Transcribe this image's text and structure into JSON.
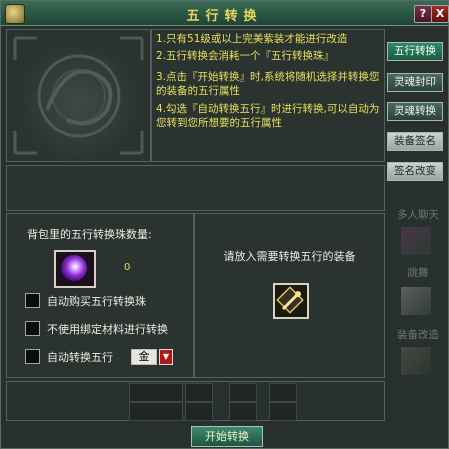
{
  "window": {
    "title": "五行转换",
    "help_label": "?",
    "close_label": "X"
  },
  "instructions": [
    "1.只有51级或以上完美紫装才能进行改造",
    "2.五行转换会消耗一个『五行转换珠』",
    "3.点击『开始转换』时,系统将随机选择并转换您的装备的五行属性",
    "4.勾选『自动转换五行』时进行转换,可以自动为您转到您所想要的五行属性"
  ],
  "left_panel": {
    "count_label": "背包里的五行转换珠数量:",
    "count_value": "0",
    "options": [
      {
        "label": "自动购买五行转换珠",
        "checked": false
      },
      {
        "label": "不使用绑定材料进行转换",
        "checked": false
      },
      {
        "label": "自动转换五行",
        "checked": false
      }
    ],
    "element_select": {
      "value": "金",
      "arrow": "▼"
    }
  },
  "right_panel": {
    "put_label": "请放入需要转换五行的装备"
  },
  "actions": {
    "start_label": "开始转换"
  },
  "side_tabs": [
    {
      "label": "五行转换",
      "state": "active"
    },
    {
      "label": "灵魂封印",
      "state": "normal"
    },
    {
      "label": "灵魂转换",
      "state": "normal"
    },
    {
      "label": "装备签名",
      "state": "light"
    },
    {
      "label": "签名改变",
      "state": "light"
    }
  ],
  "background_labels": [
    {
      "label": "多人聊天"
    },
    {
      "label": "跳舞"
    },
    {
      "label": "装备改造"
    }
  ],
  "colors": {
    "title": "#e8d85a",
    "instruction_text": "#e8e05a",
    "accent_green": "#2f8a66",
    "close_red": "#a52b2b"
  }
}
